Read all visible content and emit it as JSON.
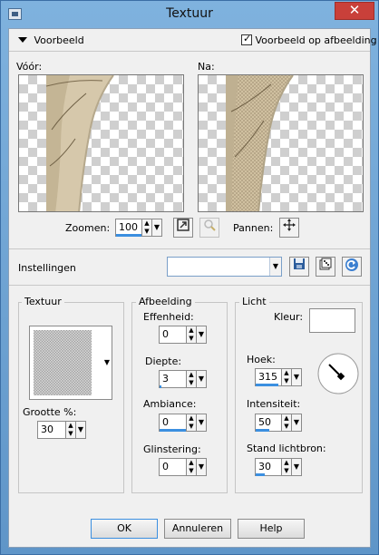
{
  "window": {
    "title": "Textuur",
    "close_glyph": "✕"
  },
  "preview_section": {
    "header_label": "Voorbeeld",
    "checkbox_label": "Voorbeeld op afbeelding",
    "checkbox_checked": true,
    "before_label": "Vóór:",
    "after_label": "Na:",
    "zoom_label": "Zoomen:",
    "zoom_value": "100",
    "pan_label": "Pannen:"
  },
  "settings": {
    "label": "Instellingen",
    "preset_value": ""
  },
  "texture_group": {
    "title": "Textuur",
    "size_label": "Grootte %:",
    "size_value": "30"
  },
  "image_group": {
    "title": "Afbeelding",
    "smoothness_label": "Effenheid:",
    "smoothness_value": "0",
    "depth_label": "Diepte:",
    "depth_value": "3",
    "ambience_label": "Ambiance:",
    "ambience_value": "0",
    "shine_label": "Glinstering:",
    "shine_value": "0"
  },
  "light_group": {
    "title": "Licht",
    "color_label": "Kleur:",
    "color_value": "#ffffff",
    "angle_label": "Hoek:",
    "angle_value": "315",
    "intensity_label": "Intensiteit:",
    "intensity_value": "50",
    "elevation_label": "Stand lichtbron:",
    "elevation_value": "30"
  },
  "buttons": {
    "ok": "OK",
    "cancel": "Annuleren",
    "help": "Help"
  },
  "icons": {
    "app": "app-icon",
    "close": "close-icon",
    "collapse": "triangle-down-icon",
    "zoom_fit": "zoom-fit-icon",
    "zoom_tool": "magnifier-icon",
    "pan": "pan-move-icon",
    "save": "save-disk-icon",
    "randomize": "dice-icon",
    "reset": "reset-icon",
    "dial": "angle-dial-icon"
  },
  "colors": {
    "accent": "#3b8fe0",
    "titlebar": "#6a9ed0",
    "close": "#c9403a",
    "surface": "#d8ccb4"
  }
}
